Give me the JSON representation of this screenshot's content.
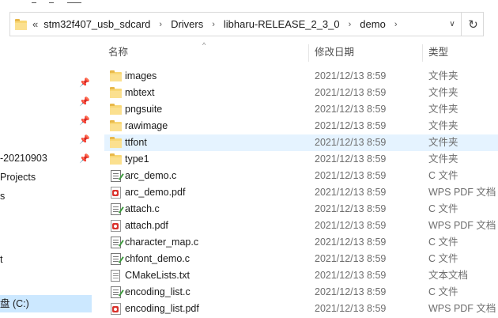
{
  "address": {
    "overflow_glyph": "«",
    "crumbs": [
      "stm32f407_usb_sdcard",
      "Drivers",
      "libharu-RELEASE_2_3_0",
      "demo"
    ],
    "separator_glyph": "›",
    "dropdown_glyph": "∨",
    "refresh_glyph": "↻"
  },
  "nav": {
    "pin_glyph": "📌",
    "items": [
      {
        "label": ""
      },
      {
        "label": ""
      },
      {
        "label": ""
      },
      {
        "label": ""
      },
      {
        "label": ""
      },
      {
        "label": "-20210903"
      },
      {
        "label": "Projects"
      },
      {
        "label": "s"
      },
      {
        "label": ""
      },
      {
        "label": ""
      },
      {
        "label": "t"
      },
      {
        "label": ""
      },
      {
        "label": ""
      },
      {
        "label": "盘 (C:)"
      }
    ]
  },
  "columns": {
    "name": "名称",
    "date": "修改日期",
    "type": "类型",
    "sort_glyph": "^"
  },
  "files": [
    {
      "name": "images",
      "date": "2021/12/13 8:59",
      "type": "文件夹",
      "icon": "folder-icon"
    },
    {
      "name": "mbtext",
      "date": "2021/12/13 8:59",
      "type": "文件夹",
      "icon": "folder-icon"
    },
    {
      "name": "pngsuite",
      "date": "2021/12/13 8:59",
      "type": "文件夹",
      "icon": "folder-icon"
    },
    {
      "name": "rawimage",
      "date": "2021/12/13 8:59",
      "type": "文件夹",
      "icon": "folder-icon"
    },
    {
      "name": "ttfont",
      "date": "2021/12/13 8:59",
      "type": "文件夹",
      "icon": "folder-icon"
    },
    {
      "name": "type1",
      "date": "2021/12/13 8:59",
      "type": "文件夹",
      "icon": "folder-icon"
    },
    {
      "name": "arc_demo.c",
      "date": "2021/12/13 8:59",
      "type": "C 文件",
      "icon": "c-file-icon"
    },
    {
      "name": "arc_demo.pdf",
      "date": "2021/12/13 8:59",
      "type": "WPS PDF 文档",
      "icon": "pdf-file-icon"
    },
    {
      "name": "attach.c",
      "date": "2021/12/13 8:59",
      "type": "C 文件",
      "icon": "c-file-icon"
    },
    {
      "name": "attach.pdf",
      "date": "2021/12/13 8:59",
      "type": "WPS PDF 文档",
      "icon": "pdf-file-icon"
    },
    {
      "name": "character_map.c",
      "date": "2021/12/13 8:59",
      "type": "C 文件",
      "icon": "c-file-icon"
    },
    {
      "name": "chfont_demo.c",
      "date": "2021/12/13 8:59",
      "type": "C 文件",
      "icon": "c-file-icon"
    },
    {
      "name": "CMakeLists.txt",
      "date": "2021/12/13 8:59",
      "type": "文本文档",
      "icon": "txt-file-icon"
    },
    {
      "name": "encoding_list.c",
      "date": "2021/12/13 8:59",
      "type": "C 文件",
      "icon": "c-file-icon"
    },
    {
      "name": "encoding_list.pdf",
      "date": "2021/12/13 8:59",
      "type": "WPS PDF 文档",
      "icon": "pdf-file-icon"
    }
  ],
  "colors": {
    "hover_row": "#e5f3ff",
    "selected_nav": "#cce8ff",
    "folder": "#f8d775"
  }
}
